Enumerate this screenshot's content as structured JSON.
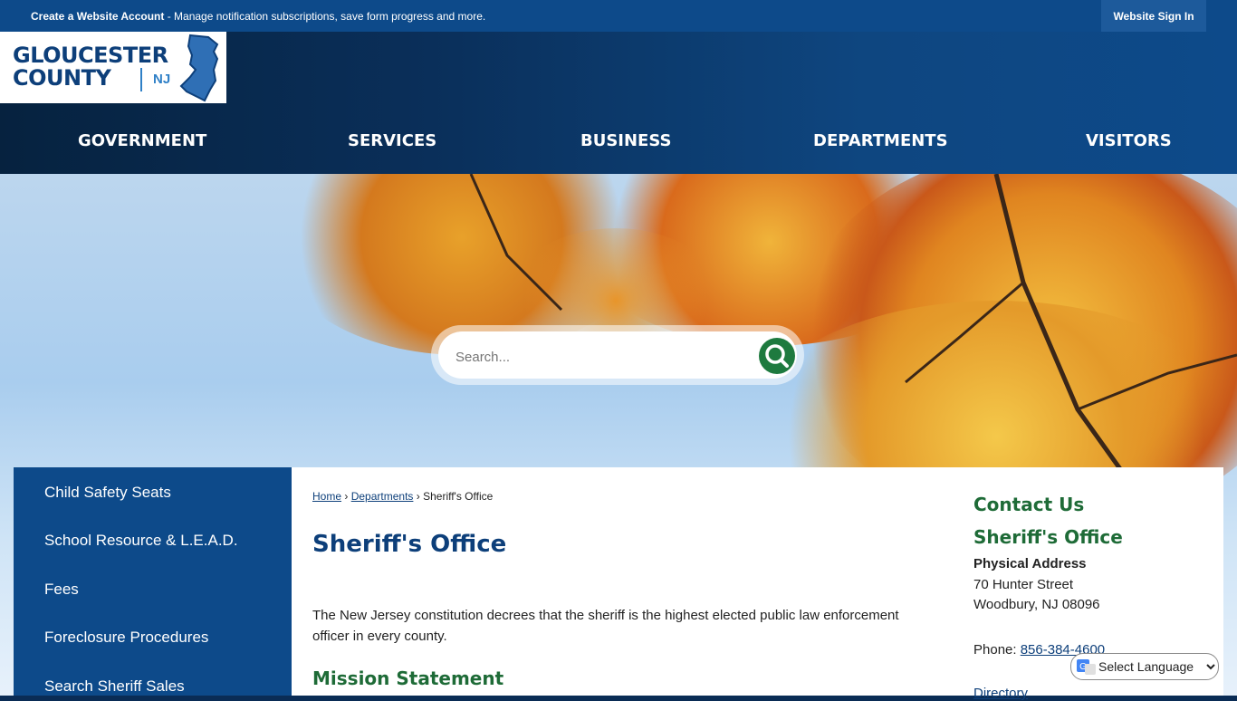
{
  "topbar": {
    "account_link": "Create a Website Account",
    "message": " - Manage notification subscriptions, save form progress and more.",
    "signin": "Website Sign In"
  },
  "logo": {
    "line1": "GLOUCESTER",
    "line2": "COUNTY",
    "state": "NJ"
  },
  "nav": [
    "GOVERNMENT",
    "SERVICES",
    "BUSINESS",
    "DEPARTMENTS",
    "VISITORS"
  ],
  "search": {
    "placeholder": "Search..."
  },
  "sidebar": {
    "items": [
      "Child Safety Seats",
      "School Resource & L.E.A.D.",
      "Fees",
      "Foreclosure Procedures",
      "Search Sheriff Sales"
    ]
  },
  "breadcrumb": {
    "home": "Home",
    "sep": "›",
    "departments": "Departments",
    "current": "Sheriff's Office"
  },
  "page": {
    "title": "Sheriff's Office",
    "intro": "The New Jersey constitution decrees that the sheriff is the highest elected public law enforcement officer in every county.",
    "mission_heading": "Mission Statement"
  },
  "contact": {
    "heading": "Contact Us",
    "office": "Sheriff's Office",
    "address_label": "Physical Address",
    "street": "70 Hunter Street",
    "city": "Woodbury, NJ 08096",
    "phone_label": "Phone: ",
    "phone": "856-384-4600",
    "directory": "Directory"
  },
  "language": {
    "label": "Select Language"
  },
  "colors": {
    "brand_blue": "#0d4a8a",
    "accent_green": "#1e7a3f"
  }
}
